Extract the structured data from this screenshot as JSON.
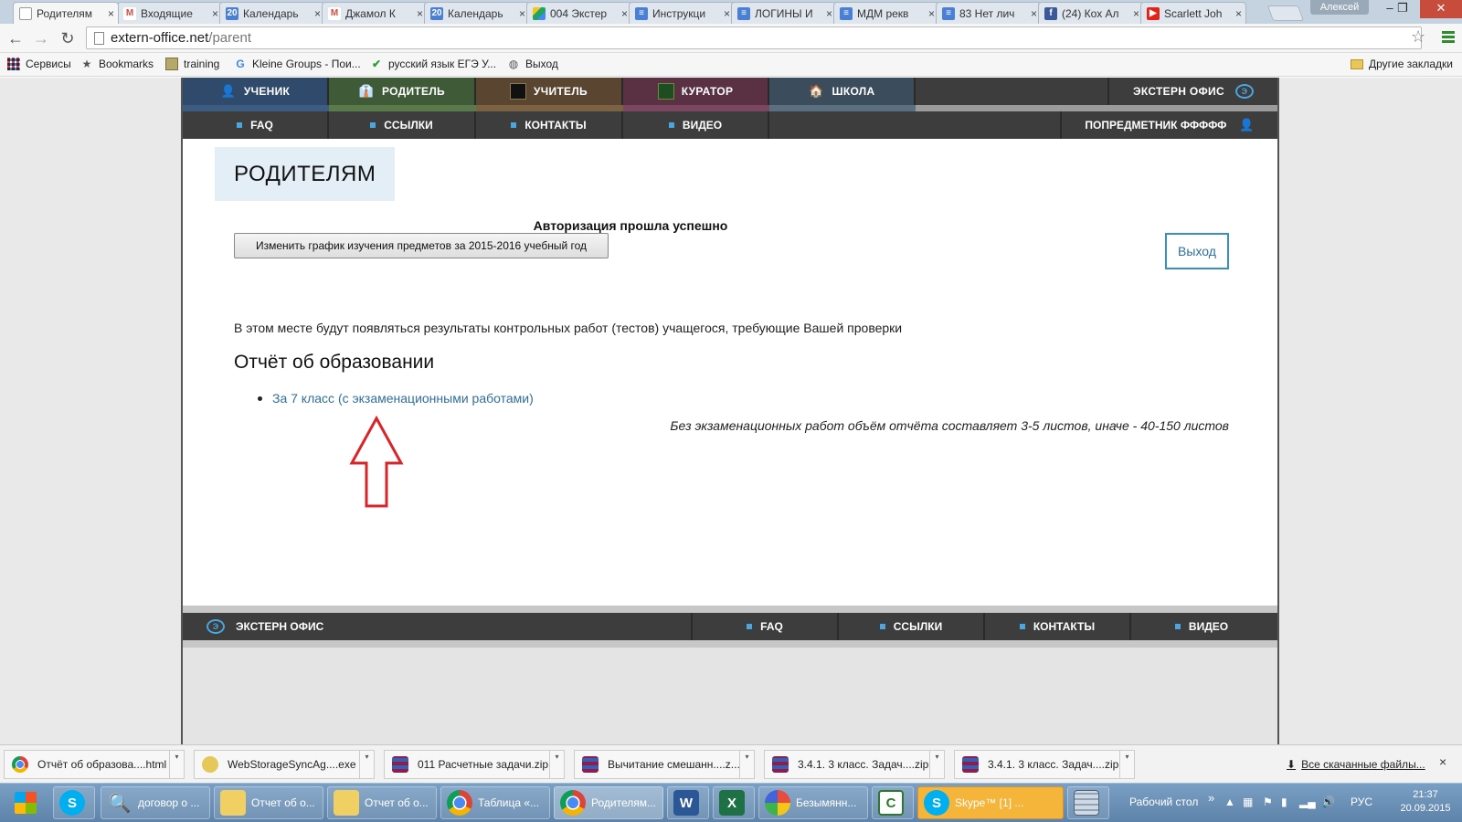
{
  "browser": {
    "tabs": [
      {
        "title": "Родителям",
        "icon": "page-icon",
        "active": true
      },
      {
        "title": "Входящие",
        "icon": "gmail-icon"
      },
      {
        "title": "Календарь",
        "icon": "calendar-icon"
      },
      {
        "title": "Джамол К",
        "icon": "gmail-icon"
      },
      {
        "title": "Календарь",
        "icon": "calendar-icon"
      },
      {
        "title": "004 Экстер",
        "icon": "drive-icon"
      },
      {
        "title": "Инструкци",
        "icon": "docs-icon"
      },
      {
        "title": "ЛОГИНЫ И",
        "icon": "docs-icon"
      },
      {
        "title": "МДМ рекв",
        "icon": "docs-icon"
      },
      {
        "title": "83 Нет лич",
        "icon": "docs-icon"
      },
      {
        "title": "(24) Кох Ал",
        "icon": "facebook-icon"
      },
      {
        "title": "Scarlett Joh",
        "icon": "youtube-icon"
      }
    ],
    "close_glyph": "×",
    "user_name": "Алексей",
    "url_host": "extern-office.net",
    "url_path": "/parent",
    "bookmarks": [
      {
        "label": "Сервисы",
        "icon": "apps-icon"
      },
      {
        "label": "Bookmarks",
        "icon": "star-icon"
      },
      {
        "label": "training",
        "icon": "folder-image-icon"
      },
      {
        "label": "Kleine Groups - Пои...",
        "icon": "google-icon"
      },
      {
        "label": "русский язык ЕГЭ У...",
        "icon": "check-icon"
      },
      {
        "label": "Выход",
        "icon": "globe-icon"
      }
    ],
    "other_bookmarks": "Другие закладки"
  },
  "site": {
    "nav_roles": [
      {
        "label": "УЧЕНИК",
        "icon": "student-icon",
        "color": "#2f4a6b"
      },
      {
        "label": "РОДИТЕЛЬ",
        "icon": "parent-icon",
        "color": "#3f5a36"
      },
      {
        "label": "УЧИТЕЛЬ",
        "icon": "teacher-icon",
        "color": "#5a4630"
      },
      {
        "label": "КУРАТОР",
        "icon": "curator-icon",
        "color": "#5a3142"
      },
      {
        "label": "ШКОЛА",
        "icon": "school-icon",
        "color": "#3b4d5d"
      }
    ],
    "brand": "ЭКСТЕРН ОФИС",
    "nav_links": [
      "FAQ",
      "ССЫЛКИ",
      "КОНТАКТЫ",
      "ВИДЕО"
    ],
    "user_link": "ПОПРЕДМЕТНИК ФФФФФ",
    "page_title": "РОДИТЕЛЯМ",
    "auth_message": "Авторизация прошла успешно",
    "schedule_button": "Изменить график изучения предметов за 2015-2016 учебный год",
    "logout_button": "Выход",
    "info_text": "В этом месте будут появляться результаты контрольных работ (тестов) учащегося, требующие Вашей проверки",
    "report_heading": "Отчёт об образовании",
    "report_link": "За 7 класс",
    "report_link_exams_open": "(",
    "report_link_exams": "с экзаменационными работами",
    "report_link_exams_close": ")",
    "report_note": "Без экзаменационных работ объём отчёта составляет 3-5 листов, иначе - 40-150 листов",
    "footer_brand": "ЭКСТЕРН ОФИС",
    "footer_links": [
      "FAQ",
      "ССЫЛКИ",
      "КОНТАКТЫ",
      "ВИДЕО"
    ],
    "accent": "#49a6e0",
    "arrow_color": "#d9242a"
  },
  "downloads": {
    "items": [
      {
        "name": "Отчёт об образова....html",
        "icon": "chrome-icon"
      },
      {
        "name": "WebStorageSyncAg....exe",
        "icon": "installer-icon"
      },
      {
        "name": "011 Расчетные задачи.zip",
        "icon": "archive-icon"
      },
      {
        "name": "Вычитание смешанн....z...",
        "icon": "archive-icon"
      },
      {
        "name": "3.4.1. 3 класс. Задач....zip",
        "icon": "archive-icon"
      },
      {
        "name": "3.4.1. 3 класс. Задач....zip",
        "icon": "archive-icon"
      }
    ],
    "show_all": "Все скачанные файлы...",
    "close_glyph": "×"
  },
  "taskbar": {
    "items": [
      {
        "label": "",
        "icon": "windows-start-icon"
      },
      {
        "label": "",
        "icon": "skype-icon"
      },
      {
        "label": "договор о ...",
        "icon": "search-doc-icon"
      },
      {
        "label": "Отчет об о...",
        "icon": "folder-icon"
      },
      {
        "label": "Отчет об о...",
        "icon": "folder-icon"
      },
      {
        "label": "Таблица «...",
        "icon": "chrome-icon"
      },
      {
        "label": "Родителям...",
        "icon": "chrome-icon"
      },
      {
        "label": "",
        "icon": "word-icon"
      },
      {
        "label": "",
        "icon": "excel-icon"
      },
      {
        "label": "Безымянн...",
        "icon": "paint-icon"
      },
      {
        "label": "",
        "icon": "camtasia-icon"
      },
      {
        "label": "Skype™ [1] ...",
        "icon": "skype-icon"
      },
      {
        "label": "",
        "icon": "calculator-icon"
      }
    ],
    "desktop_label": "Рабочий стол",
    "language": "РУС",
    "time": "21:37",
    "date": "20.09.2015"
  }
}
